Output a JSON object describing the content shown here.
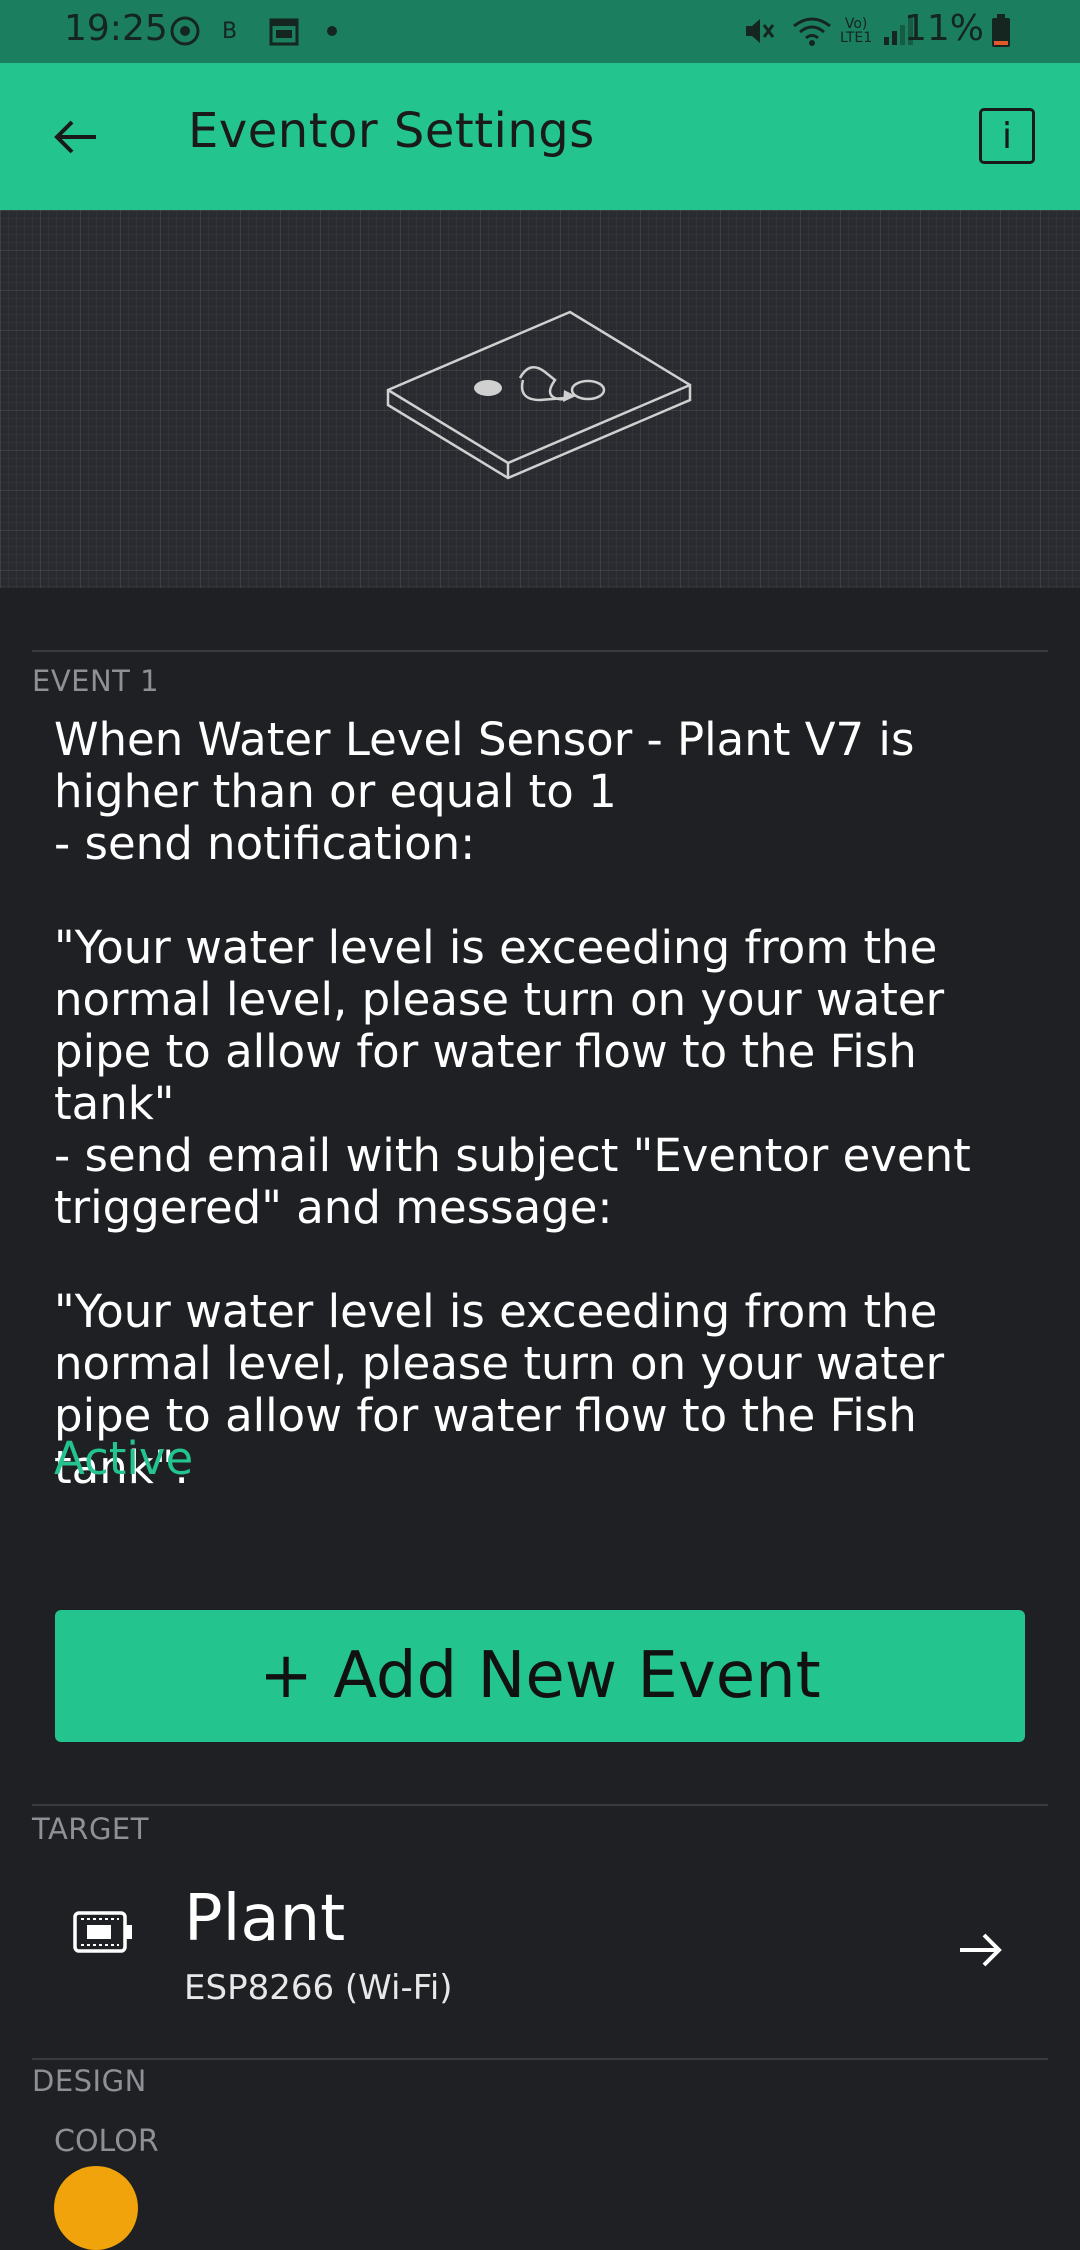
{
  "status_bar": {
    "time": "19:25",
    "battery": "11%",
    "network": "LTE1",
    "icons": [
      "sync-icon",
      "b-icon",
      "calendar-icon",
      "dot-icon",
      "mute-icon",
      "wifi-icon",
      "volte-icon",
      "signal-icon",
      "battery-icon"
    ]
  },
  "app_bar": {
    "title": "Eventor Settings",
    "info_label": "i"
  },
  "event_section": {
    "label": "EVENT 1",
    "description": "When Water Level Sensor - Plant V7 is higher than or equal to 1\n- send notification:\n\n\"Your water level is exceeding from the normal level, please turn on your water pipe to allow for water flow to the Fish tank\"\n- send email with subject \"Eventor event triggered\" and message:\n\n\"Your water level is exceeding from the normal level, please turn on your water pipe to allow for water flow to the Fish tank\".",
    "status": "Active"
  },
  "add_event_button": "+ Add New Event",
  "target_section": {
    "label": "TARGET",
    "device_name": "Plant",
    "device_type": "ESP8266 (Wi-Fi)"
  },
  "design_section": {
    "label": "DESIGN",
    "color_label": "COLOR",
    "color_value": "#f0a30a"
  },
  "colors": {
    "accent": "#23c48e",
    "background": "#1f2024",
    "status_bar": "#1b7f5f"
  }
}
